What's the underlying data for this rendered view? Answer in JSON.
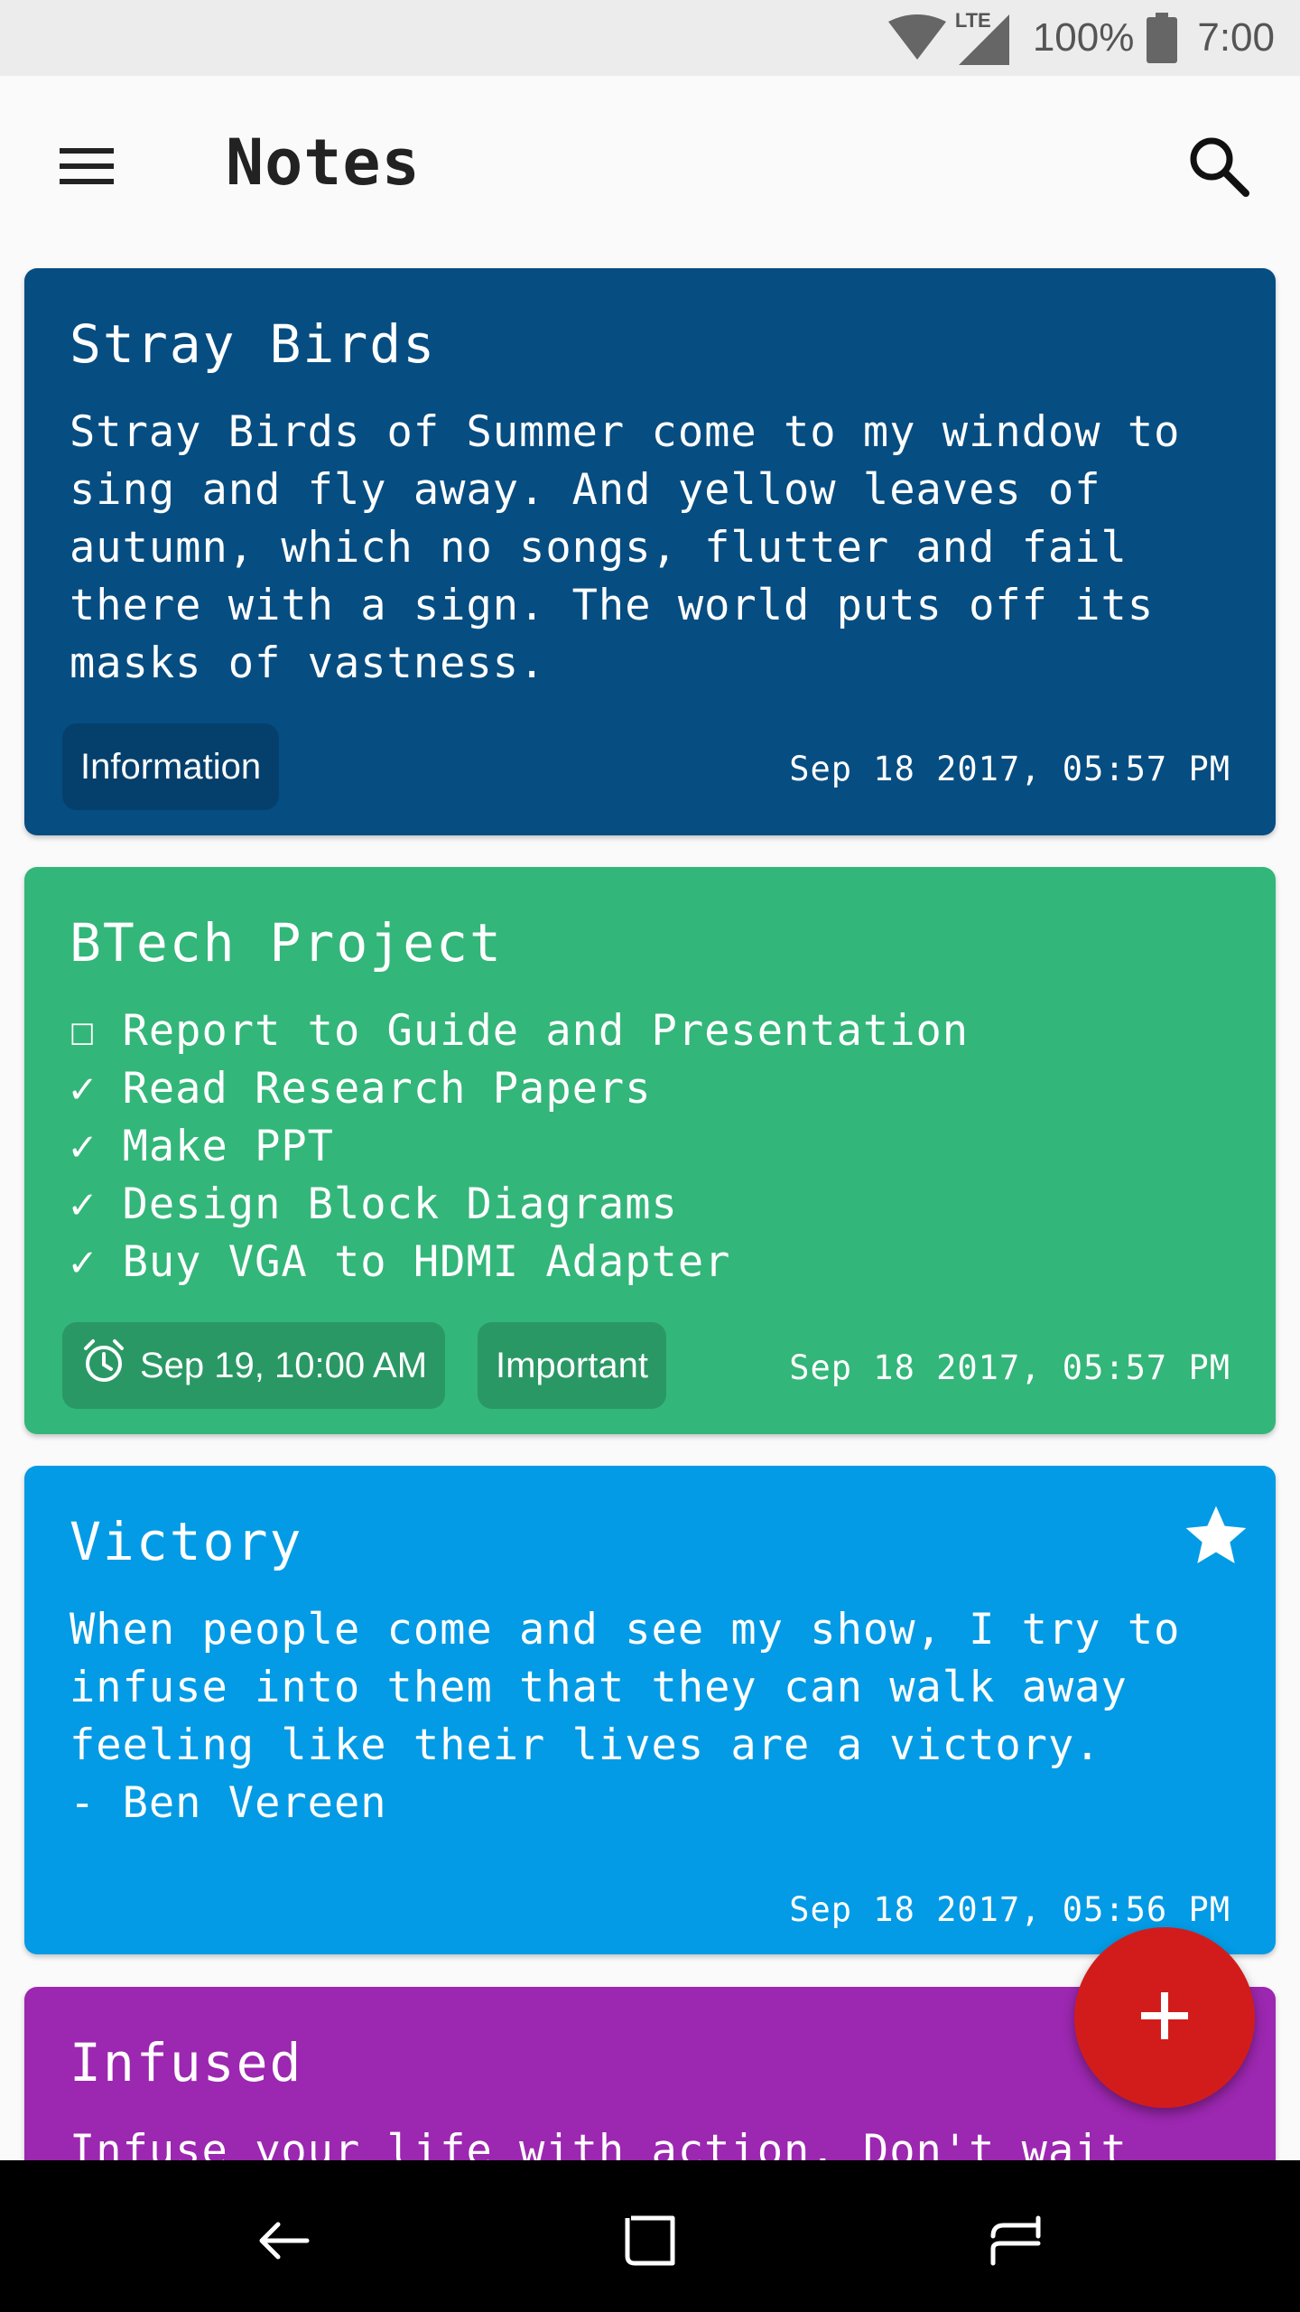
{
  "status_bar": {
    "battery": "100%",
    "time": "7:00",
    "network": "LTE",
    "icons": [
      "wifi-icon",
      "lte-signal-icon",
      "battery-icon"
    ]
  },
  "app_bar": {
    "title": "Notes",
    "icons": [
      "menu-icon",
      "search-icon"
    ]
  },
  "notes": [
    {
      "title": "Stray Birds",
      "body": "Stray Birds of Summer come to my window to\nsing and fly away. And yellow leaves of\nautumn, which no songs, flutter and fail\nthere with a sign. The world puts off its\nmasks of vastness.",
      "tags": [
        "Information"
      ],
      "date": "Sep 18 2017, 05:57 PM",
      "color": "#064d82"
    },
    {
      "title": "BTech Project",
      "body": "☐ Report to Guide and Presentation\n✓ Read Research Papers\n✓ Make PPT\n✓ Design Block Diagrams\n✓ Buy VGA to HDMI Adapter",
      "reminder": "Sep 19, 10:00 AM",
      "tags": [
        "Important"
      ],
      "date": "Sep 18 2017, 05:57 PM",
      "color": "#33b679"
    },
    {
      "title": "Victory",
      "body": "When people come and see my show, I try to\ninfuse into them that they can walk away\nfeeling like their lives are a victory.\n- Ben Vereen",
      "date": "Sep 18 2017, 05:56 PM",
      "starred": true,
      "color": "#039be5"
    },
    {
      "title": "Infused",
      "body": "Infuse your life with action. Don't wait",
      "color": "#9c27b0"
    }
  ],
  "fab": {
    "icon": "add-icon",
    "color": "#d21c1c"
  },
  "nav_bar": {
    "icons": [
      "back-icon",
      "home-icon",
      "recents-icon"
    ]
  }
}
